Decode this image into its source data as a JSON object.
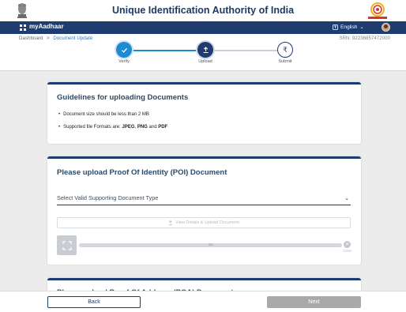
{
  "header": {
    "title": "Unique Identification Authority of India",
    "emblem_icon": "national-emblem-icon",
    "logo_icon": "aadhaar-logo-icon"
  },
  "nav": {
    "app_name": "myAadhaar",
    "language": "English",
    "language_icon": "translate-icon"
  },
  "breadcrumb": {
    "home": "Dashboard",
    "separator": ">",
    "current": "Document Update"
  },
  "srn": "SRN: 92236857472000",
  "stepper": {
    "steps": [
      {
        "label": "Verify",
        "icon": "check-icon",
        "state": "done"
      },
      {
        "label": "Upload",
        "icon": "upload-icon",
        "state": "current"
      },
      {
        "label": "Submit",
        "icon": "rupee-icon",
        "state": "todo"
      }
    ]
  },
  "guidelines": {
    "title": "Guidelines for uploading Documents",
    "bullet1": "Document size should be less than 2 MB",
    "bullet2_prefix": "Supported file Formats are: ",
    "bullet2_fmt1": "JPEG",
    "bullet2_sep1": ", ",
    "bullet2_fmt2": "PNG",
    "bullet2_sep2": " and ",
    "bullet2_fmt3": "PDF"
  },
  "poi": {
    "title": "Please upload Proof Of Identity (POI) Document",
    "select_placeholder": "Select Valid Supporting Document Type",
    "upload_label": "View Details & Upload Document",
    "progress_text": "0%",
    "clear_label": "Clear"
  },
  "poa": {
    "title": "Please upload Proof Of Address (POA) Document"
  },
  "footer": {
    "back_label": "Back",
    "next_label": "Next"
  },
  "colors": {
    "navy": "#1e3c70",
    "accent_blue": "#1e8bd0",
    "disabled_gray": "#a9a9a9"
  }
}
